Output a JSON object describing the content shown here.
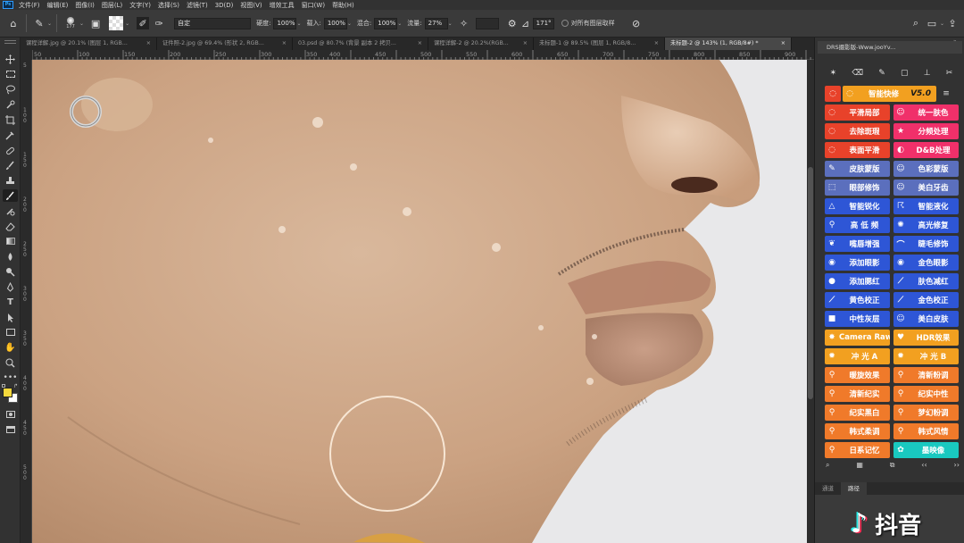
{
  "menubar": {
    "app_icon": "Ps",
    "items": [
      "文件(F)",
      "编辑(E)",
      "图像(I)",
      "图层(L)",
      "文字(Y)",
      "选择(S)",
      "滤镜(T)",
      "3D(D)",
      "视图(V)",
      "增效工具",
      "窗口(W)",
      "帮助(H)"
    ]
  },
  "options": {
    "brush_size": "177",
    "preset": "自定",
    "opacity_label": "硬度:",
    "opacity_value": "100%",
    "load_label": "载入:",
    "load_value": "100%",
    "mix_label": "混合:",
    "mix_value": "100%",
    "flow_label": "流量:",
    "flow_value": "27%",
    "angle_value": "171°",
    "sample_all_label": "对所有图层取样"
  },
  "tabs": [
    {
      "label": "课程详解.jpg @ 20.1% (图层 1, RGB...",
      "active": false
    },
    {
      "label": "证件照-2.jpg @ 69.4% (形状 2, RGB...",
      "active": false
    },
    {
      "label": "03.psd @ 80.7% (背景 副本 2 拷贝...",
      "active": false
    },
    {
      "label": "课程详解-2 @ 20.2%(RGB...",
      "active": false
    },
    {
      "label": "未标题-1 @ 89.5% (图层 1, RGB/8...",
      "active": false
    },
    {
      "label": "未标题-2 @ 143% (1, RGB/8#) *",
      "active": true
    }
  ],
  "ruler_top": [
    "50",
    "100",
    "150",
    "200",
    "250",
    "300",
    "350",
    "400",
    "450",
    "500",
    "550",
    "600",
    "650",
    "700",
    "750",
    "800",
    "850",
    "900",
    "950"
  ],
  "ruler_left": [
    "5",
    "1 0 0",
    "1 5 0",
    "2 0 0",
    "2 5 0",
    "3 0 0",
    "3 5 0",
    "4 0 0",
    "4 5 0",
    "5 0 0"
  ],
  "panel": {
    "title": "DRS摄影版-Www.jooYv...",
    "buttons": [
      {
        "label": "智能快修",
        "extra": "V5.0",
        "color": "#f2a020",
        "icon": "lasso-icon",
        "glyph": "◌"
      },
      {
        "label": "平滑局部",
        "color": "#e8422a",
        "icon": "lasso-icon",
        "glyph": "◌"
      },
      {
        "label": "统一肤色",
        "color": "#f0306a",
        "icon": "face-icon",
        "glyph": "☺"
      },
      {
        "label": "去除斑瑕",
        "color": "#e8422a",
        "icon": "lasso-icon",
        "glyph": "◌"
      },
      {
        "label": "分频处理",
        "color": "#f0306a",
        "icon": "star-icon",
        "glyph": "★"
      },
      {
        "label": "表面平滑",
        "color": "#e8422a",
        "icon": "lasso-icon",
        "glyph": "◌"
      },
      {
        "label": "D&B处理",
        "color": "#f0306a",
        "icon": "circle-half-icon",
        "glyph": "◐"
      },
      {
        "label": "皮肤蒙版",
        "color": "#5b6fbd",
        "icon": "brush-icon",
        "glyph": "✎"
      },
      {
        "label": "色彩蒙版",
        "color": "#5b6fbd",
        "icon": "face-icon",
        "glyph": "☺"
      },
      {
        "label": "眼部修饰",
        "color": "#5b6fbd",
        "icon": "marquee-icon",
        "glyph": "⬚"
      },
      {
        "label": "美白牙齿",
        "color": "#5b6fbd",
        "icon": "face-icon",
        "glyph": "☺"
      },
      {
        "label": "智能锐化",
        "color": "#2e56d6",
        "icon": "triangle-icon",
        "glyph": "△"
      },
      {
        "label": "智能液化",
        "color": "#2e56d6",
        "icon": "liquify-icon",
        "glyph": "☈"
      },
      {
        "label": "高 低 频",
        "color": "#2e56d6",
        "icon": "pin-icon",
        "glyph": "⚲"
      },
      {
        "label": "高光修复",
        "color": "#2e56d6",
        "icon": "swirl-icon",
        "glyph": "✺"
      },
      {
        "label": "嘴唇增强",
        "color": "#2e56d6",
        "icon": "lips-icon",
        "glyph": "❦"
      },
      {
        "label": "睫毛修饰",
        "color": "#2e56d6",
        "icon": "lash-icon",
        "glyph": "⌒"
      },
      {
        "label": "添加眼影",
        "color": "#2e56d6",
        "icon": "eye-icon",
        "glyph": "◉"
      },
      {
        "label": "金色眼影",
        "color": "#2e56d6",
        "icon": "eye-icon",
        "glyph": "◉"
      },
      {
        "label": "添加腮红",
        "color": "#2e56d6",
        "icon": "blush-icon",
        "glyph": "●"
      },
      {
        "label": "肤色减红",
        "color": "#2e56d6",
        "icon": "dropper-icon",
        "glyph": "⟋"
      },
      {
        "label": "黄色校正",
        "color": "#2e56d6",
        "icon": "dropper-icon",
        "glyph": "⟋"
      },
      {
        "label": "金色校正",
        "color": "#2e56d6",
        "icon": "dropper-icon",
        "glyph": "⟋"
      },
      {
        "label": "中性灰层",
        "color": "#2e56d6",
        "icon": "square-icon",
        "glyph": "■"
      },
      {
        "label": "美白皮肤",
        "color": "#2e56d6",
        "icon": "face-icon",
        "glyph": "☺"
      },
      {
        "label": "Camera Raw",
        "color": "#f2a020",
        "icon": "sun-icon",
        "glyph": "✸"
      },
      {
        "label": "HDR效果",
        "color": "#f2a020",
        "icon": "heart-icon",
        "glyph": "♥"
      },
      {
        "label": "冲 光 A",
        "color": "#f2a020",
        "icon": "sun-icon",
        "glyph": "✹"
      },
      {
        "label": "冲 光 B",
        "color": "#f2a020",
        "icon": "sun-icon",
        "glyph": "✹"
      },
      {
        "label": "暖旋效果",
        "color": "#f07a2a",
        "icon": "pin-icon",
        "glyph": "⚲"
      },
      {
        "label": "清新粉调",
        "color": "#f07a2a",
        "icon": "pin-icon",
        "glyph": "⚲"
      },
      {
        "label": "清新纪实",
        "color": "#f07a2a",
        "icon": "pin-icon",
        "glyph": "⚲"
      },
      {
        "label": "纪实中性",
        "color": "#f07a2a",
        "icon": "pin-icon",
        "glyph": "⚲"
      },
      {
        "label": "纪实黑白",
        "color": "#f07a2a",
        "icon": "pin-icon",
        "glyph": "⚲"
      },
      {
        "label": "梦幻粉调",
        "color": "#f07a2a",
        "icon": "pin-icon",
        "glyph": "⚲"
      },
      {
        "label": "韩式柔调",
        "color": "#f07a2a",
        "icon": "pin-icon",
        "glyph": "⚲"
      },
      {
        "label": "韩式风情",
        "color": "#f07a2a",
        "icon": "pin-icon",
        "glyph": "⚲"
      },
      {
        "label": "日系记忆",
        "color": "#f07a2a",
        "icon": "pin-icon",
        "glyph": "⚲"
      },
      {
        "label": "墨映像",
        "color": "#19c9c0",
        "icon": "ink-icon",
        "glyph": "✿"
      }
    ],
    "bottom_tools": [
      "search-icon",
      "film-icon",
      "layers-icon",
      "back-icon",
      "forward-icon"
    ],
    "lower_tabs": [
      {
        "label": "通道",
        "active": false
      },
      {
        "label": "路径",
        "active": true
      }
    ]
  },
  "watermark": "抖音",
  "colors": {
    "foreground": "#f4d83c",
    "background": "#ffffff"
  }
}
